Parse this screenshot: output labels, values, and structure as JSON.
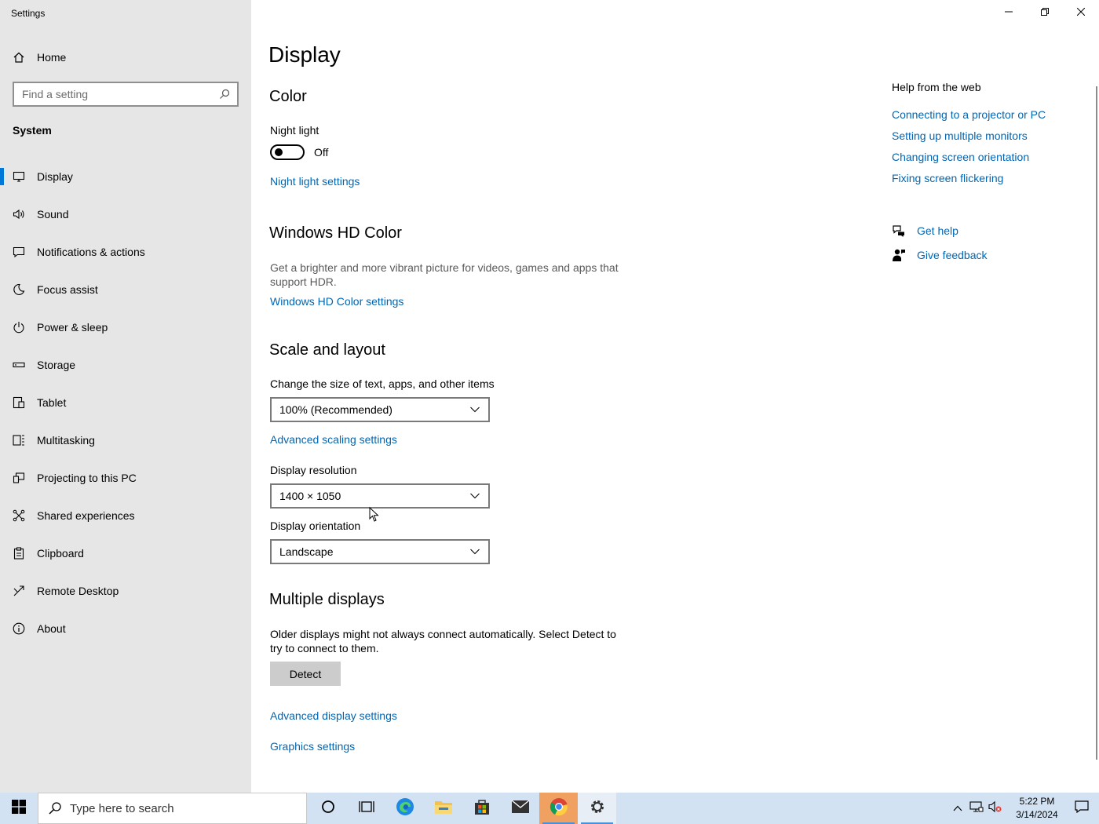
{
  "window": {
    "app_title": "Settings",
    "controls": {
      "minimize": "minimize-icon",
      "restore": "restore-icon",
      "close": "close-icon"
    }
  },
  "sidebar": {
    "home_label": "Home",
    "search_placeholder": "Find a setting",
    "section_label": "System",
    "items": [
      {
        "label": "Display",
        "icon": "monitor-icon",
        "active": true
      },
      {
        "label": "Sound",
        "icon": "speaker-icon"
      },
      {
        "label": "Notifications & actions",
        "icon": "notification-icon"
      },
      {
        "label": "Focus assist",
        "icon": "moon-icon"
      },
      {
        "label": "Power & sleep",
        "icon": "power-icon"
      },
      {
        "label": "Storage",
        "icon": "storage-icon"
      },
      {
        "label": "Tablet",
        "icon": "tablet-icon"
      },
      {
        "label": "Multitasking",
        "icon": "multitasking-icon"
      },
      {
        "label": "Projecting to this PC",
        "icon": "projector-icon"
      },
      {
        "label": "Shared experiences",
        "icon": "shared-icon"
      },
      {
        "label": "Clipboard",
        "icon": "clipboard-icon"
      },
      {
        "label": "Remote Desktop",
        "icon": "remote-icon"
      },
      {
        "label": "About",
        "icon": "info-icon"
      }
    ]
  },
  "main": {
    "title": "Display",
    "color": {
      "heading": "Color",
      "night_light_label": "Night light",
      "night_light_state": "Off",
      "night_light_link": "Night light settings"
    },
    "hdr": {
      "heading": "Windows HD Color",
      "description": "Get a brighter and more vibrant picture for videos, games and apps that support HDR.",
      "link": "Windows HD Color settings"
    },
    "scale": {
      "heading": "Scale and layout",
      "size_label": "Change the size of text, apps, and other items",
      "size_value": "100% (Recommended)",
      "advanced_link": "Advanced scaling settings",
      "resolution_label": "Display resolution",
      "resolution_value": "1400 × 1050",
      "orientation_label": "Display orientation",
      "orientation_value": "Landscape"
    },
    "multiple": {
      "heading": "Multiple displays",
      "description": "Older displays might not always connect automatically. Select Detect to try to connect to them.",
      "detect_button": "Detect",
      "advanced_link": "Advanced display settings",
      "graphics_link": "Graphics settings"
    }
  },
  "help": {
    "title": "Help from the web",
    "links": [
      "Connecting to a projector or PC",
      "Setting up multiple monitors",
      "Changing screen orientation",
      "Fixing screen flickering"
    ],
    "get_help": "Get help",
    "give_feedback": "Give feedback"
  },
  "taskbar": {
    "search_placeholder": "Type here to search",
    "apps": [
      "cortana-icon",
      "task-view-icon",
      "edge-icon",
      "file-explorer-icon",
      "store-icon",
      "mail-icon",
      "chrome-icon",
      "settings-icon"
    ],
    "time": "5:22 PM",
    "date": "3/14/2024"
  },
  "colors": {
    "accent": "#0078d7",
    "link": "#0066b4",
    "sidebar_bg": "#e6e6e6",
    "taskbar_bg": "#d2e2f2"
  }
}
